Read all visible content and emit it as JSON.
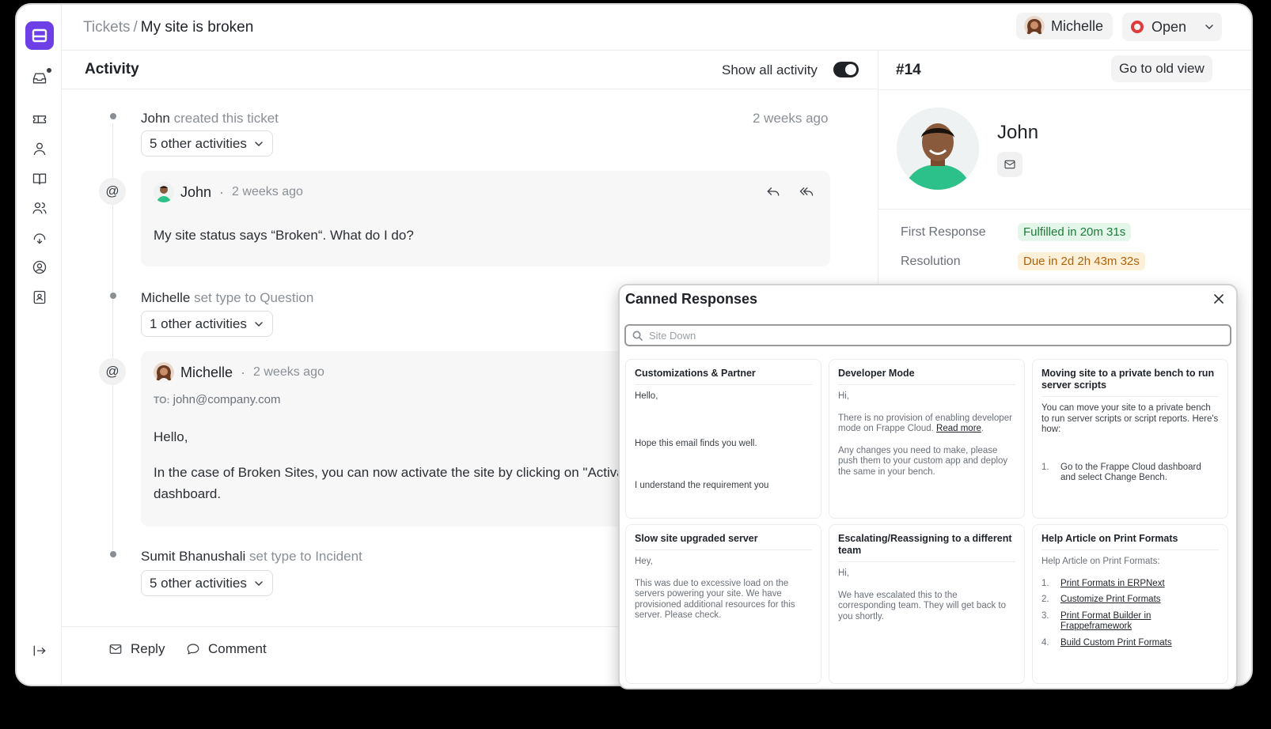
{
  "breadcrumb": {
    "parent": "Tickets",
    "separator": "/",
    "current": "My site is broken"
  },
  "header": {
    "assignee": "Michelle",
    "status": "Open"
  },
  "activity": {
    "title": "Activity",
    "show_all_label": "Show all activity",
    "events": [
      {
        "actor": "John",
        "action": "created this ticket",
        "time": "2 weeks ago",
        "collapsed": "5 other activities"
      },
      {
        "actor": "Michelle",
        "action": "set type to Question",
        "collapsed": "1 other activities"
      },
      {
        "actor": "Sumit Bhanushali",
        "action": "set type to Incident",
        "collapsed": "5 other activities"
      }
    ],
    "emails": [
      {
        "author": "John",
        "time": "2 weeks ago",
        "body": "My site status says “Broken“. What do I do?"
      },
      {
        "author": "Michelle",
        "time": "2 weeks ago",
        "to_label": "TO:",
        "to": "john@company.com",
        "greeting": "Hello,",
        "line1": "In the case of Broken Sites, you can now activate the site by clicking on \"Activa",
        "line2": "dashboard."
      }
    ],
    "at_symbol": "@",
    "reply_label": "Reply",
    "comment_label": "Comment"
  },
  "ticket": {
    "number": "#14",
    "old_view_label": "Go to old view",
    "contact_name": "John",
    "first_response_label": "First Response",
    "first_response_value": "Fulfilled in 20m 31s",
    "resolution_label": "Resolution",
    "resolution_value": "Due in 2d 2h 43m 32s"
  },
  "canned": {
    "title": "Canned Responses",
    "search_placeholder": "Site Down",
    "cards": [
      {
        "title": "Customizations & Partner",
        "p1": "Hello,",
        "p2": "Hope this email finds you well.",
        "p3": "I understand the requirement you"
      },
      {
        "title": "Developer Mode",
        "p1": "Hi,",
        "p2": "There is no provision of enabling developer mode on Frappe Cloud.",
        "link": "Read more",
        "p3": "Any changes you need to make, please push them to your custom app and deploy the same in your bench."
      },
      {
        "title": "Moving site to a private bench to run server scripts",
        "p1": "You can move your site to a private bench to run server scripts or script reports. Here's how:",
        "li1_n": "1.",
        "li1": "Go to the Frappe Cloud dashboard and select Change Bench."
      },
      {
        "title": "Slow site upgraded server",
        "p1": "Hey,",
        "p2": "This was due to excessive load on the servers powering your site. We have provisioned additional resources for this server. Please check."
      },
      {
        "title": "Escalating/Reassigning to a different team",
        "p1": "Hi,",
        "p2": "We have escalated this to the corresponding team. They will get back to you shortly."
      },
      {
        "title": "Help Article on Print Formats",
        "p1": "Help Article on Print Formats:",
        "items": [
          {
            "n": "1.",
            "text": "Print Formats in ERPNext"
          },
          {
            "n": "2.",
            "text": "Customize Print Formats"
          },
          {
            "n": "3.",
            "text": "Print Format Builder in Frappeframework"
          },
          {
            "n": "4.",
            "text": "Build Custom Print Formats"
          }
        ]
      }
    ]
  },
  "icons": {
    "logo": "helpdesk-logo-icon",
    "rail": [
      "inbox-icon",
      "ticket-icon",
      "user-icon",
      "book-icon",
      "users-icon",
      "headset-icon",
      "user-circle-icon",
      "contact-card-icon",
      "collapse-sidebar-icon"
    ]
  },
  "colors": {
    "brand": "#6d3fe6",
    "status_open": "#e03b3b",
    "sla_green": "#1f7a3c",
    "sla_amber": "#b0620b"
  }
}
